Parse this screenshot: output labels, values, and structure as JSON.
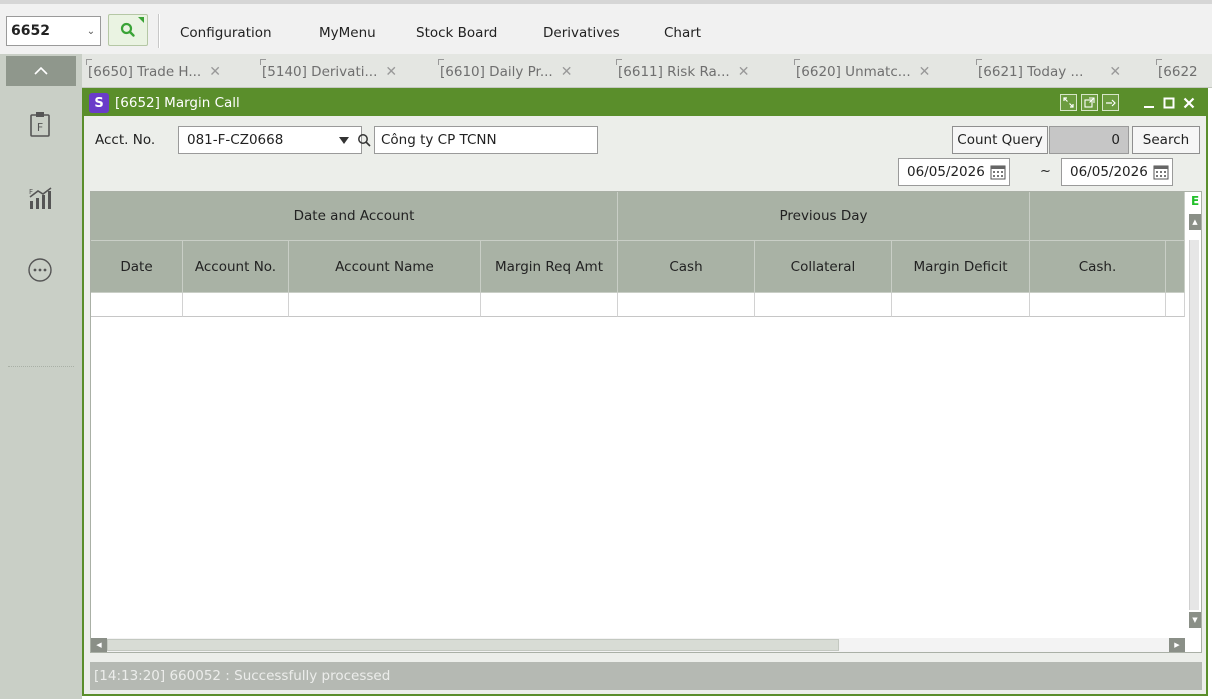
{
  "toolbar": {
    "screen_code": "6652",
    "menu": [
      "Configuration",
      "MyMenu",
      "Stock Board",
      "Derivatives",
      "Chart"
    ]
  },
  "tabs": [
    {
      "label": "[6650] Trade H..."
    },
    {
      "label": "[5140] Derivati..."
    },
    {
      "label": "[6610] Daily Pr..."
    },
    {
      "label": "[6611] Risk Ra..."
    },
    {
      "label": "[6620] Unmatc..."
    },
    {
      "label": "[6621] Today ..."
    },
    {
      "label": "[6622"
    }
  ],
  "window": {
    "title": "[6652] Margin Call",
    "account_label": "Acct. No.",
    "account_value": "081-F-CZ0668",
    "account_name": "Công ty CP TCNN",
    "count_query_label": "Count Query",
    "count_value": "0",
    "search_label": "Search",
    "date_from": "06/05/2026",
    "date_sep": "~",
    "date_to": "06/05/2026"
  },
  "grid": {
    "group_headers": [
      "Date and Account",
      "Previous Day"
    ],
    "columns": [
      "Date",
      "Account No.",
      "Account Name",
      "Margin Req Amt",
      "Cash",
      "Collateral",
      "Margin Deficit",
      "Cash."
    ],
    "edge_marker": "E"
  },
  "status": {
    "message": "[14:13:20] 660052 : Successfully processed"
  }
}
